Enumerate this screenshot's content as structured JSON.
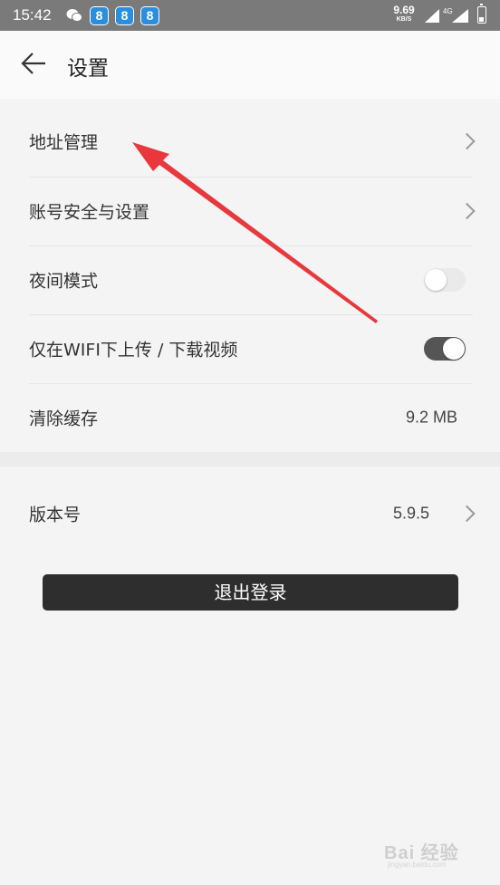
{
  "status_bar": {
    "time": "15:42",
    "notification_badges": [
      "8",
      "8",
      "8"
    ],
    "net_speed_value": "9.69",
    "net_speed_unit": "KB/S",
    "network_type": "4G",
    "battery_level": 0.35
  },
  "header": {
    "title": "设置",
    "back_icon": "arrow-left-icon"
  },
  "settings": {
    "address_label": "地址管理",
    "account_label": "账号安全与设置",
    "night_mode_label": "夜间模式",
    "night_mode_on": false,
    "wifi_only_label": "仅在WIFI下上传 / 下载视频",
    "wifi_only_on": true,
    "clear_cache_label": "清除缓存",
    "cache_size": "9.2 MB",
    "version_label": "版本号",
    "version_value": "5.9.5"
  },
  "logout_label": "退出登录",
  "annotation_color": "#e8383d",
  "watermark": {
    "text": "Bai 经验",
    "sub": "jingyan.baidu.com"
  }
}
